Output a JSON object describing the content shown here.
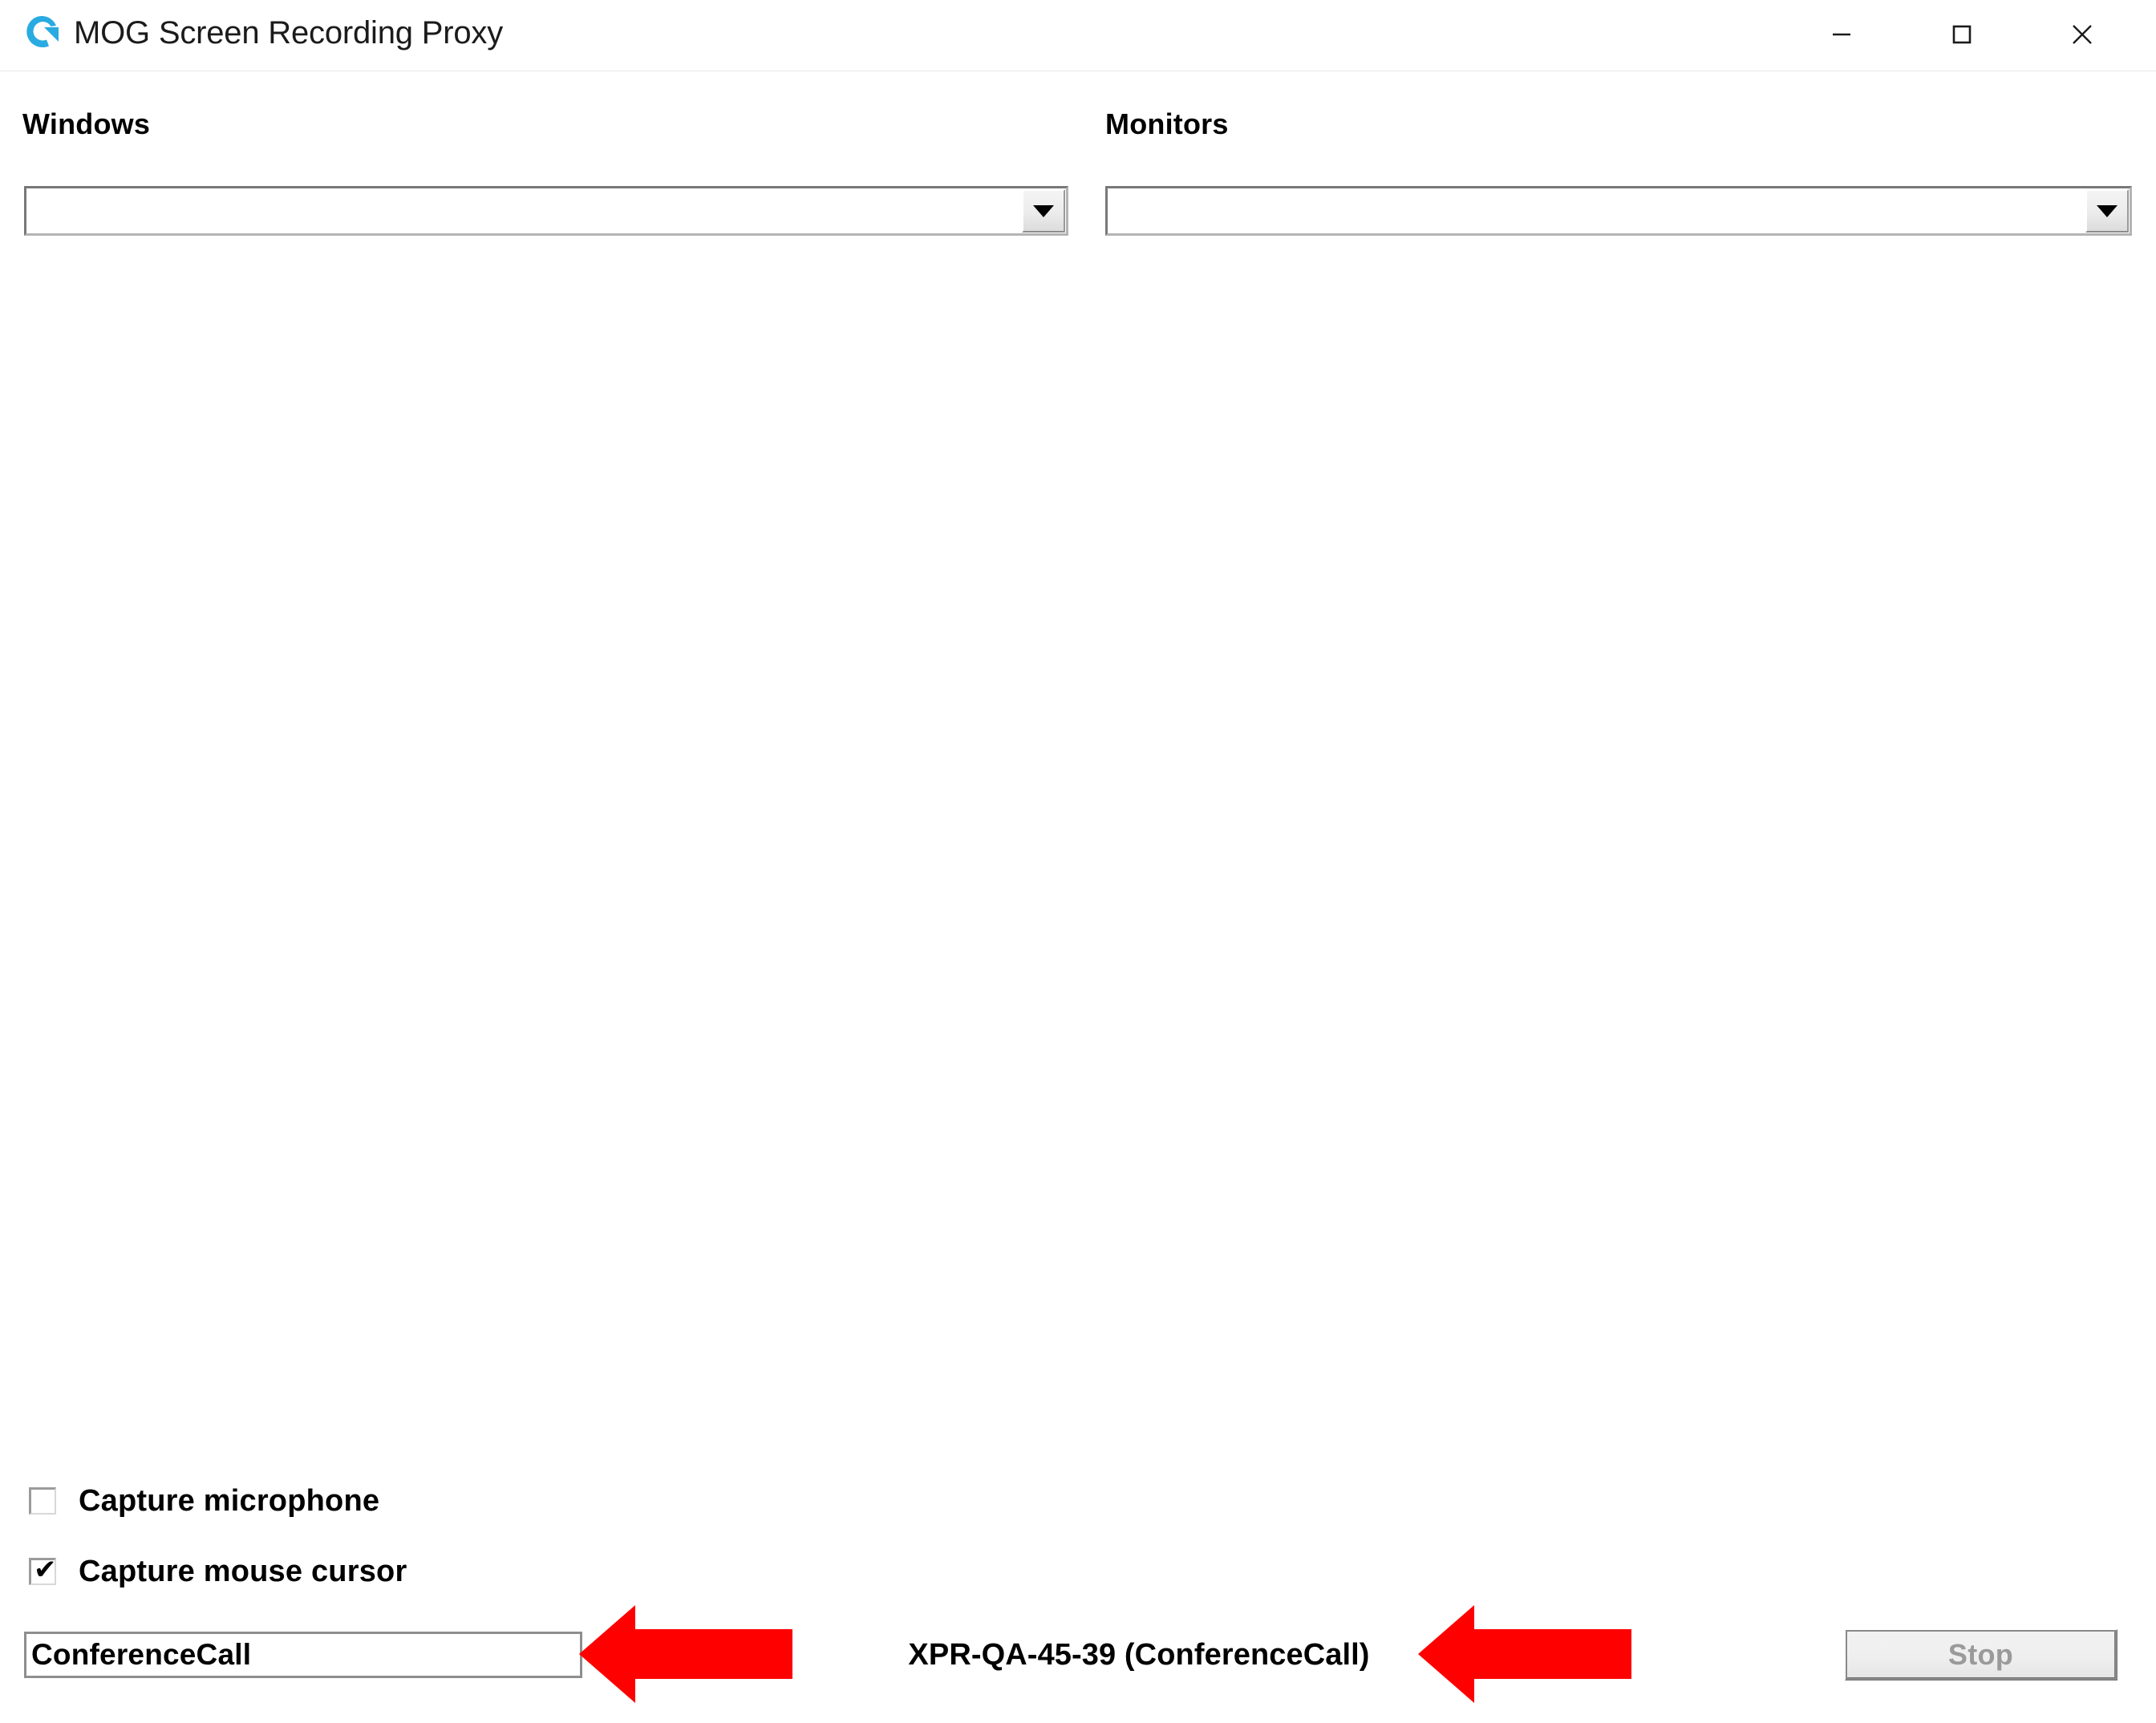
{
  "window": {
    "title": "MOG Screen Recording Proxy",
    "logo_icon": "mog-circular-arrow-logo",
    "logo_color": "#29ABE2",
    "controls": {
      "minimize_label": "Minimize",
      "maximize_label": "Maximize",
      "close_label": "Close"
    }
  },
  "sources": {
    "windows": {
      "label": "Windows",
      "selected": "",
      "placeholder": "",
      "dropdown_icon": "chevron-down-icon"
    },
    "monitors": {
      "label": "Monitors",
      "selected": "",
      "placeholder": "",
      "dropdown_icon": "chevron-down-icon"
    }
  },
  "options": [
    {
      "label": "Capture microphone",
      "checked": false,
      "tick": ""
    },
    {
      "label": "Capture mouse cursor",
      "checked": true,
      "tick": "✔"
    }
  ],
  "footer": {
    "recording_name": {
      "value": "ConferenceCall",
      "placeholder": ""
    },
    "status": "XPR-QA-45-39 (ConferenceCall)",
    "stop_button": {
      "label": "Stop",
      "disabled": true
    }
  },
  "annotations": {
    "color": "#FF0000",
    "arrow_name_field": "arrow-pointing-left-at-recording-name-field",
    "arrow_status": "arrow-pointing-left-at-status-text"
  }
}
